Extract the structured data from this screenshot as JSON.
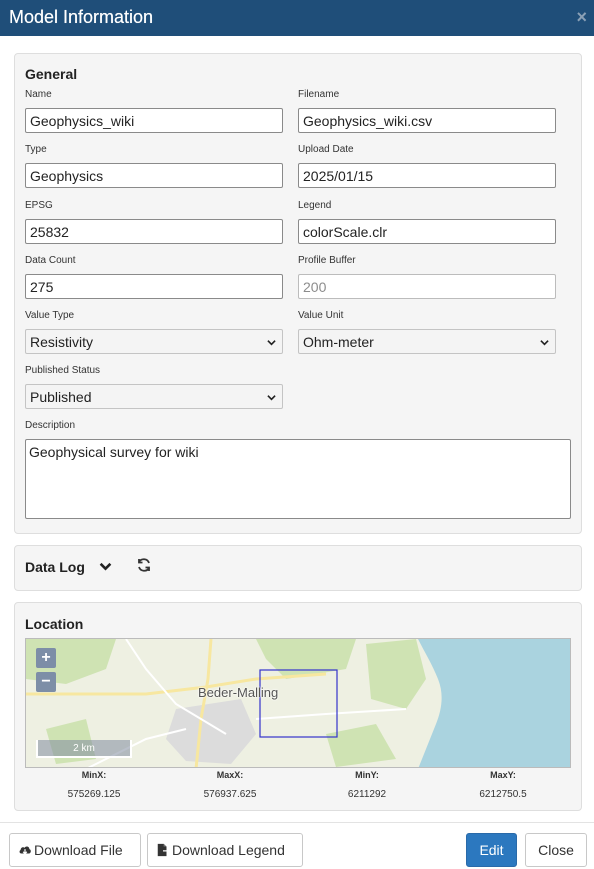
{
  "header": {
    "title": "Model Information",
    "close_symbol": "×"
  },
  "general": {
    "heading": "General",
    "fields": {
      "name": {
        "label": "Name",
        "value": "Geophysics_wiki"
      },
      "filename": {
        "label": "Filename",
        "value": "Geophysics_wiki.csv"
      },
      "type": {
        "label": "Type",
        "value": "Geophysics"
      },
      "upload_date": {
        "label": "Upload Date",
        "value": "2025/01/15"
      },
      "epsg": {
        "label": "EPSG",
        "value": "25832"
      },
      "legend": {
        "label": "Legend",
        "value": "colorScale.clr"
      },
      "data_count": {
        "label": "Data Count",
        "value": "275"
      },
      "profile_buffer": {
        "label": "Profile Buffer",
        "placeholder": "200"
      },
      "value_type": {
        "label": "Value Type",
        "selected": "Resistivity"
      },
      "value_unit": {
        "label": "Value Unit",
        "selected": "Ohm-meter"
      },
      "published_status": {
        "label": "Published Status",
        "selected": "Published"
      },
      "description": {
        "label": "Description",
        "value": "Geophysical survey for wiki"
      }
    }
  },
  "data_log": {
    "heading": "Data Log",
    "toggle_icon": "chevron-down-icon",
    "refresh_icon": "refresh-icon"
  },
  "location": {
    "heading": "Location",
    "map": {
      "zoom_in": "+",
      "zoom_out": "−",
      "place_label": "Beder-Malling",
      "scale_label": "2 km"
    },
    "bbox": [
      {
        "label": "MinX:",
        "value": "575269.125"
      },
      {
        "label": "MaxX:",
        "value": "576937.625"
      },
      {
        "label": "MinY:",
        "value": "6211292"
      },
      {
        "label": "MaxY:",
        "value": "6212750.5"
      }
    ]
  },
  "footer": {
    "download_file": "Download File",
    "download_legend": "Download Legend",
    "edit": "Edit",
    "close": "Close"
  },
  "colors": {
    "header_bg": "#1f4e79",
    "primary_button": "#2c78bf",
    "map_water": "#aad3df",
    "map_land": "#eef0e2",
    "bbox_outline": "#3333cc"
  }
}
